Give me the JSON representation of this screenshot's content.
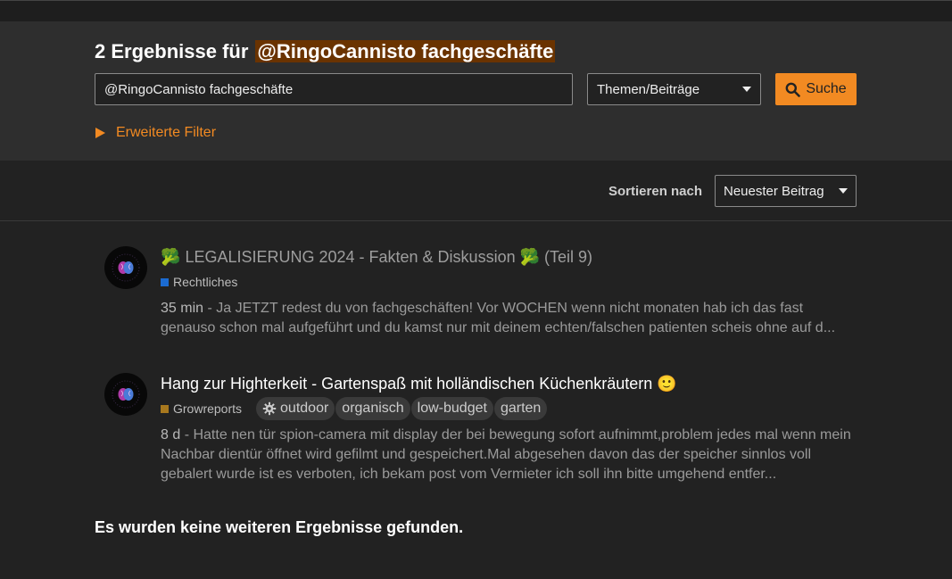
{
  "header": {
    "result_count_text": "2 Ergebnisse für",
    "query_highlight": "@RingoCannisto fachgeschäfte"
  },
  "search": {
    "value": "@RingoCannisto fachgeschäfte",
    "scope_selected": "Themen/Beiträge",
    "button_label": "Suche",
    "advanced_filter_label": "Erweiterte Filter"
  },
  "sort": {
    "label": "Sortieren nach",
    "selected": "Neuester Beitrag"
  },
  "results": [
    {
      "title_prefix_emoji": "🥦",
      "title": "LEGALISIERUNG 2024 - Fakten & Diskussion",
      "title_suffix_emoji": "🥦",
      "title_part": "(Teil 9)",
      "category": "Rechtliches",
      "category_color": "#1b6bd1",
      "tags": [],
      "ago": "35 min",
      "excerpt": "Ja JETZT redest du von fachgeschäften! Vor WOCHEN wenn nicht monaten hab ich das fast genauso schon mal aufgeführt und du kamst nur mit deinem echten/falschen patienten scheis ohne auf d..."
    },
    {
      "title": "Hang zur Highterkeit - Gartenspaß mit holländischen Küchenkräutern",
      "title_suffix_emoji": "🙂",
      "category": "Growreports",
      "category_color": "#a8781e",
      "tags": [
        "outdoor",
        "organisch",
        "low-budget",
        "garten"
      ],
      "ago": "8 d",
      "excerpt": "Hatte nen tür spion-camera mit display der bei bewegung sofort aufnimmt,problem jedes mal wenn mein Nachbar dientür öffnet wird gefilmt und gespeichert.Mal abgesehen davon das der speicher sinnlos voll gebalert wurde ist es verboten, ich bekam post vom Vermieter ich soll ihn bitte umgehend entfer..."
    }
  ],
  "footer": {
    "no_more_text": "Es wurden keine weiteren Ergebnisse gefunden."
  },
  "colors": {
    "accent": "#f28a22",
    "highlight_bg": "#6a3300"
  }
}
